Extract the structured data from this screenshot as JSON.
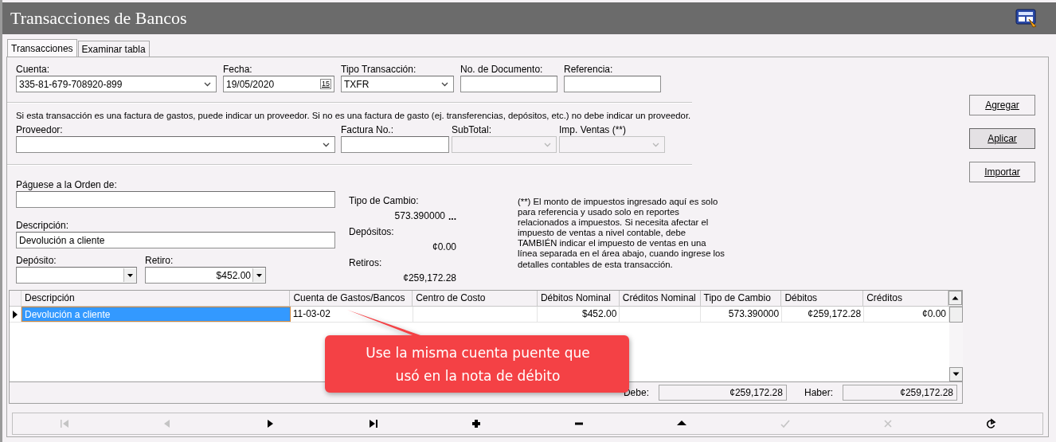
{
  "window": {
    "title": "Transacciones de Bancos"
  },
  "tabs": [
    {
      "label": "Transacciones",
      "selected": true
    },
    {
      "label": "Examinar tabla",
      "selected": false
    }
  ],
  "account_row": [
    {
      "label": "Cuenta:",
      "value": "335-81-679-708920-899",
      "kind": "combo",
      "disabled": false
    },
    {
      "label": "Fecha:",
      "value": "19/05/2020",
      "kind": "date",
      "disabled": false
    },
    {
      "label": "Tipo Transacción:",
      "value": "TXFR",
      "kind": "combo",
      "disabled": false
    },
    {
      "label": "No. de Documento:",
      "kind": "text",
      "disabled": false
    },
    {
      "label": "Referencia:",
      "kind": "text",
      "disabled": false
    }
  ],
  "date_button": "15",
  "vendor_note": "Si esta transacción es una factura de gastos, puede indicar un proveedor. Si no es una factura de gasto (ej. transferencias, depósitos, etc.) no debe indicar un proveedor.",
  "vendor_row": [
    {
      "label": "Proveedor:",
      "kind": "combo",
      "disabled": false
    },
    {
      "label": "Factura No.:",
      "kind": "text",
      "disabled": false
    },
    {
      "label": "SubTotal:",
      "kind": "combo",
      "disabled": true
    },
    {
      "label": "Imp. Ventas (**)",
      "kind": "combo",
      "disabled": true
    }
  ],
  "payee": {
    "label": "Páguese a la Orden de:"
  },
  "description": {
    "label": "Descripción:",
    "value": "Devolución a cliente"
  },
  "deposit": {
    "label": "Depósito:"
  },
  "withdrawal": {
    "label": "Retiro:",
    "value": "$452.00"
  },
  "exchange": {
    "label": "Tipo de Cambio:",
    "value": "573.390000",
    "button": "..."
  },
  "deposits": {
    "label": "Depósitos:",
    "value": "¢0.00"
  },
  "withdrawals": {
    "label": "Retiros:",
    "value": "¢259,172.28"
  },
  "tax_note": "(**) El monto de impuestos ingresado aquí es solo para referencia y usado solo en reportes relacionados a impuestos. Si necesita afectar el impuesto de ventas a nivel contable, debe TAMBIÉN indicar el impuesto de ventas en una línea separada en el área abajo, cuando ingrese los detalles contables de esta transacción.",
  "buttons": [
    {
      "label": "Agregar",
      "pressed": false
    },
    {
      "label": "Aplicar",
      "pressed": true
    },
    {
      "label": "Importar",
      "pressed": false
    }
  ],
  "table": {
    "columns": [
      "Descripción",
      "Cuenta de Gastos/Bancos",
      "Centro de Costo",
      "Débitos Nominal",
      "Créditos Nominal",
      "Tipo de Cambio",
      "Débitos",
      "Créditos"
    ],
    "rows": [
      {
        "selected": true,
        "cells": [
          "Devolución a cliente",
          "11-03-02",
          "",
          "$452.00",
          "",
          "573.390000",
          "¢259,172.28",
          "¢0.00"
        ]
      }
    ],
    "totals": [
      {
        "label": "Debe:",
        "value": "¢259,172.28"
      },
      {
        "label": "Haber:",
        "value": "¢259,172.28"
      }
    ]
  },
  "callout": {
    "text": "Use la misma cuenta puente que usó en la nota de débito"
  },
  "navigator": [
    {
      "kind": "first",
      "disabled": true
    },
    {
      "kind": "prev",
      "disabled": true
    },
    {
      "kind": "next",
      "disabled": false
    },
    {
      "kind": "last",
      "disabled": false
    },
    {
      "kind": "add",
      "disabled": false
    },
    {
      "kind": "delete",
      "disabled": false
    },
    {
      "kind": "up",
      "disabled": false
    },
    {
      "kind": "post",
      "disabled": true
    },
    {
      "kind": "cancel",
      "disabled": true
    },
    {
      "kind": "refresh",
      "disabled": false
    }
  ]
}
